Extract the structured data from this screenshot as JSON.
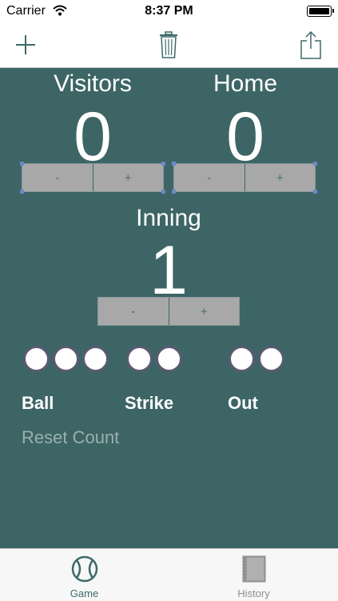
{
  "status": {
    "carrier": "Carrier",
    "time": "8:37 PM"
  },
  "toolbar": {
    "add_icon": "plus-icon",
    "delete_icon": "trash-icon",
    "share_icon": "share-icon"
  },
  "visitors": {
    "label": "Visitors",
    "score": "0",
    "minus": "-",
    "plus": "+"
  },
  "home": {
    "label": "Home",
    "score": "0",
    "minus": "-",
    "plus": "+"
  },
  "inning": {
    "label": "Inning",
    "value": "1",
    "minus": "-",
    "plus": "+"
  },
  "count": {
    "ball_label": "Ball",
    "strike_label": "Strike",
    "out_label": "Out",
    "balls_max": 3,
    "strikes_max": 2,
    "outs_max": 2,
    "reset_label": "Reset Count"
  },
  "tabs": [
    {
      "label": "Game",
      "icon": "baseball-icon",
      "active": true
    },
    {
      "label": "History",
      "icon": "notebook-icon",
      "active": false
    }
  ],
  "colors": {
    "background": "#3d6565",
    "accent": "#3d6a6a",
    "stepper": "#a8a8a8"
  }
}
